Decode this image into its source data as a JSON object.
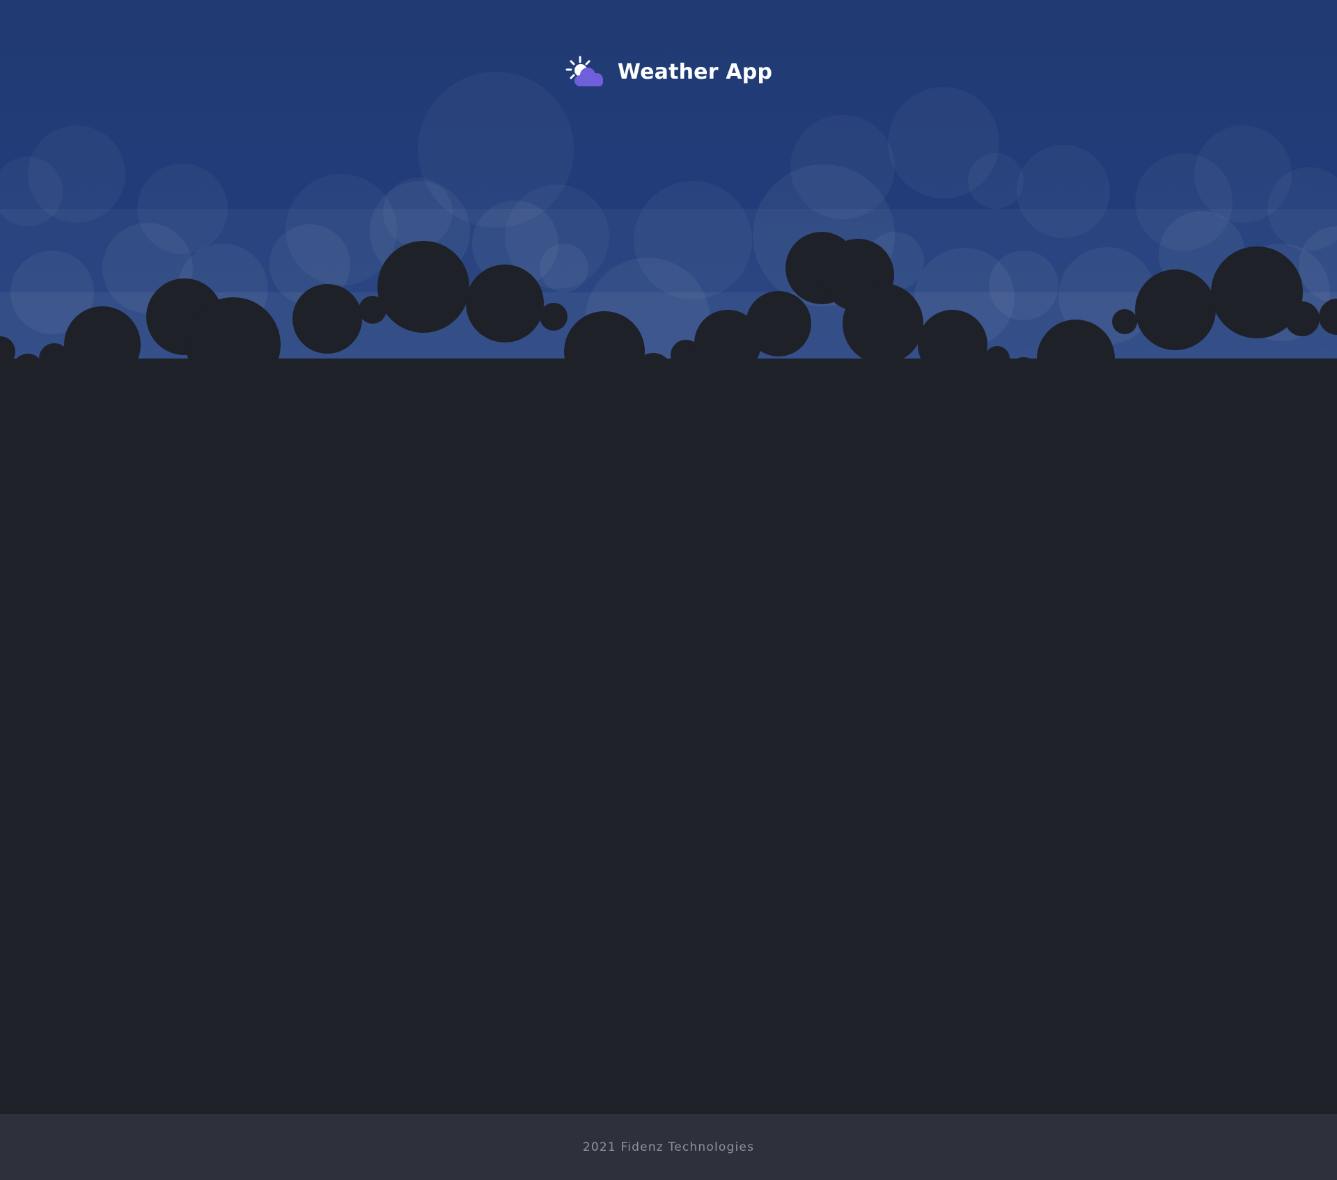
{
  "header": {
    "logo_icon": "sun-behind-cloud-icon",
    "title": "Weather App"
  },
  "colors": {
    "sky": "#213b76",
    "cloud_light": "#2b4680",
    "cloud_dark": "#1f2129",
    "background": "#1f2129",
    "footer_bg": "#2e313b",
    "logo_cloud": "#6f5fdb",
    "logo_sun": "#ffffff"
  },
  "footer": {
    "text": "2021 Fidenz Technologies"
  }
}
